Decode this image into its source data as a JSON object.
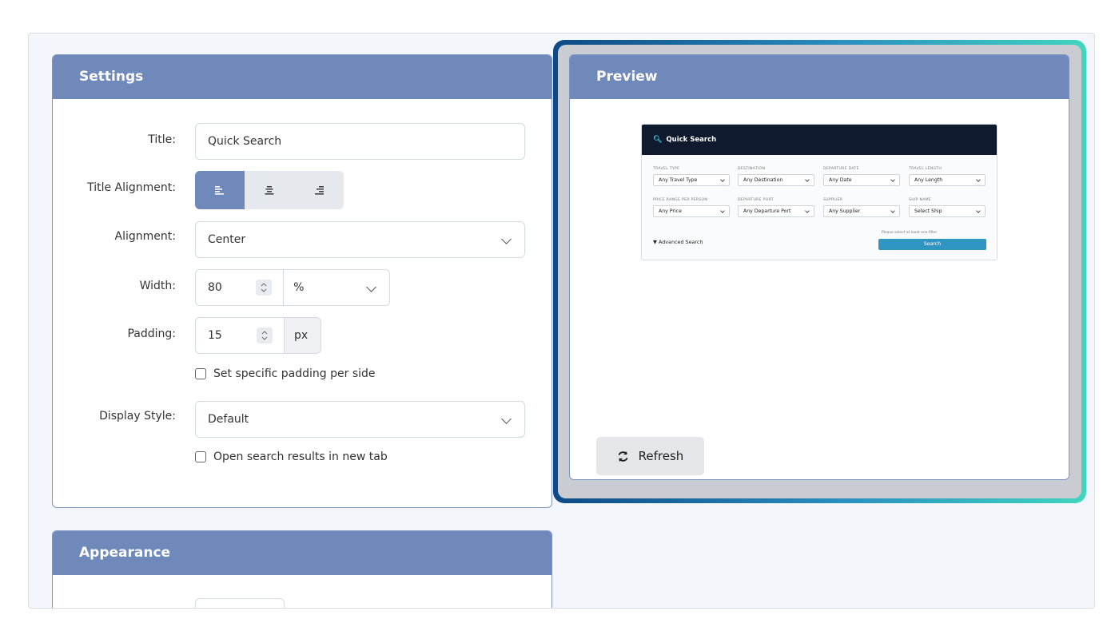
{
  "settings": {
    "header": "Settings",
    "title_label": "Title:",
    "title_value": "Quick Search",
    "title_alignment_label": "Title Alignment:",
    "alignment_label": "Alignment:",
    "alignment_value": "Center",
    "width_label": "Width:",
    "width_value": "80",
    "width_unit": "%",
    "padding_label": "Padding:",
    "padding_value": "15",
    "padding_unit": "px",
    "padding_per_side_label": "Set specific padding per side",
    "display_style_label": "Display Style:",
    "display_style_value": "Default",
    "new_tab_label": "Open search results in new tab"
  },
  "appearance": {
    "header": "Appearance"
  },
  "preview": {
    "header": "Preview",
    "refresh_label": "Refresh",
    "widget": {
      "title": "Quick Search",
      "fields": [
        {
          "label": "TRAVEL TYPE",
          "value": "Any Travel Type"
        },
        {
          "label": "DESTINATION",
          "value": "Any Destination"
        },
        {
          "label": "DEPARTURE DATE",
          "value": "Any Date"
        },
        {
          "label": "TRAVEL LENGTH",
          "value": "Any Length"
        },
        {
          "label": "PRICE RANGE PER PERSON",
          "value": "Any Price"
        },
        {
          "label": "DEPARTURE PORT",
          "value": "Any Departure Port"
        },
        {
          "label": "SUPPLIER",
          "value": "Any Supplier"
        },
        {
          "label": "SHIP NAME",
          "value": "Select Ship"
        }
      ],
      "advanced_label": "▼ Advanced Search",
      "hint": "Please select at least one filter",
      "search_label": "Search"
    }
  },
  "colors": {
    "panel_header": "#6f89bb",
    "accent": "#2f96c4",
    "widget_head": "#101a2e"
  }
}
